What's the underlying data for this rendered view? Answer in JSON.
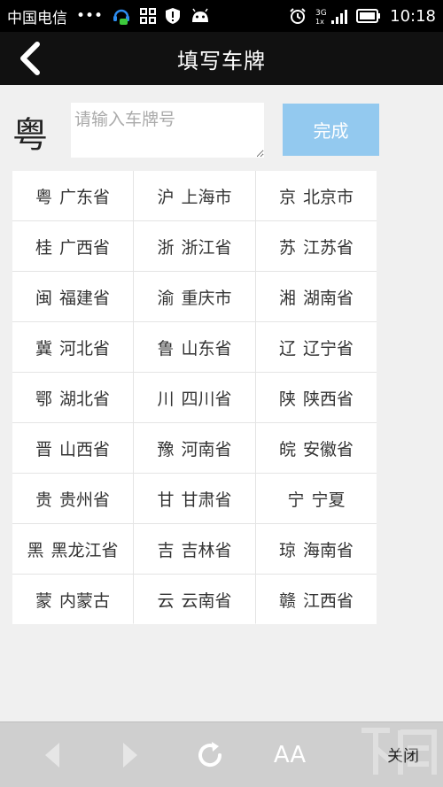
{
  "status_bar": {
    "carrier": "中国电信",
    "dots": "•••",
    "network": "3G",
    "time": "10:18"
  },
  "header": {
    "title": "填写车牌"
  },
  "plate": {
    "prefix": "粤",
    "placeholder": "请输入车牌号",
    "value": "",
    "done_label": "完成"
  },
  "provinces": [
    {
      "abbr": "粤",
      "name": "广东省"
    },
    {
      "abbr": "沪",
      "name": "上海市"
    },
    {
      "abbr": "京",
      "name": "北京市"
    },
    {
      "abbr": "桂",
      "name": "广西省"
    },
    {
      "abbr": "浙",
      "name": "浙江省"
    },
    {
      "abbr": "苏",
      "name": "江苏省"
    },
    {
      "abbr": "闽",
      "name": "福建省"
    },
    {
      "abbr": "渝",
      "name": "重庆市"
    },
    {
      "abbr": "湘",
      "name": "湖南省"
    },
    {
      "abbr": "冀",
      "name": "河北省"
    },
    {
      "abbr": "鲁",
      "name": "山东省"
    },
    {
      "abbr": "辽",
      "name": "辽宁省"
    },
    {
      "abbr": "鄂",
      "name": "湖北省"
    },
    {
      "abbr": "川",
      "name": "四川省"
    },
    {
      "abbr": "陕",
      "name": "陕西省"
    },
    {
      "abbr": "晋",
      "name": "山西省"
    },
    {
      "abbr": "豫",
      "name": "河南省"
    },
    {
      "abbr": "皖",
      "name": "安徽省"
    },
    {
      "abbr": "贵",
      "name": "贵州省"
    },
    {
      "abbr": "甘",
      "name": "甘肃省"
    },
    {
      "abbr": "宁",
      "name": "宁夏"
    },
    {
      "abbr": "黑",
      "name": "黑龙江省"
    },
    {
      "abbr": "吉",
      "name": "吉林省"
    },
    {
      "abbr": "琼",
      "name": "海南省"
    },
    {
      "abbr": "蒙",
      "name": "内蒙古"
    },
    {
      "abbr": "云",
      "name": "云南省"
    },
    {
      "abbr": "赣",
      "name": "江西省"
    }
  ],
  "toolbar": {
    "font_label": "AA",
    "close_label": "关闭"
  },
  "colors": {
    "accent": "#93c9ef",
    "header_bg": "#111111",
    "status_bg": "#000000"
  }
}
